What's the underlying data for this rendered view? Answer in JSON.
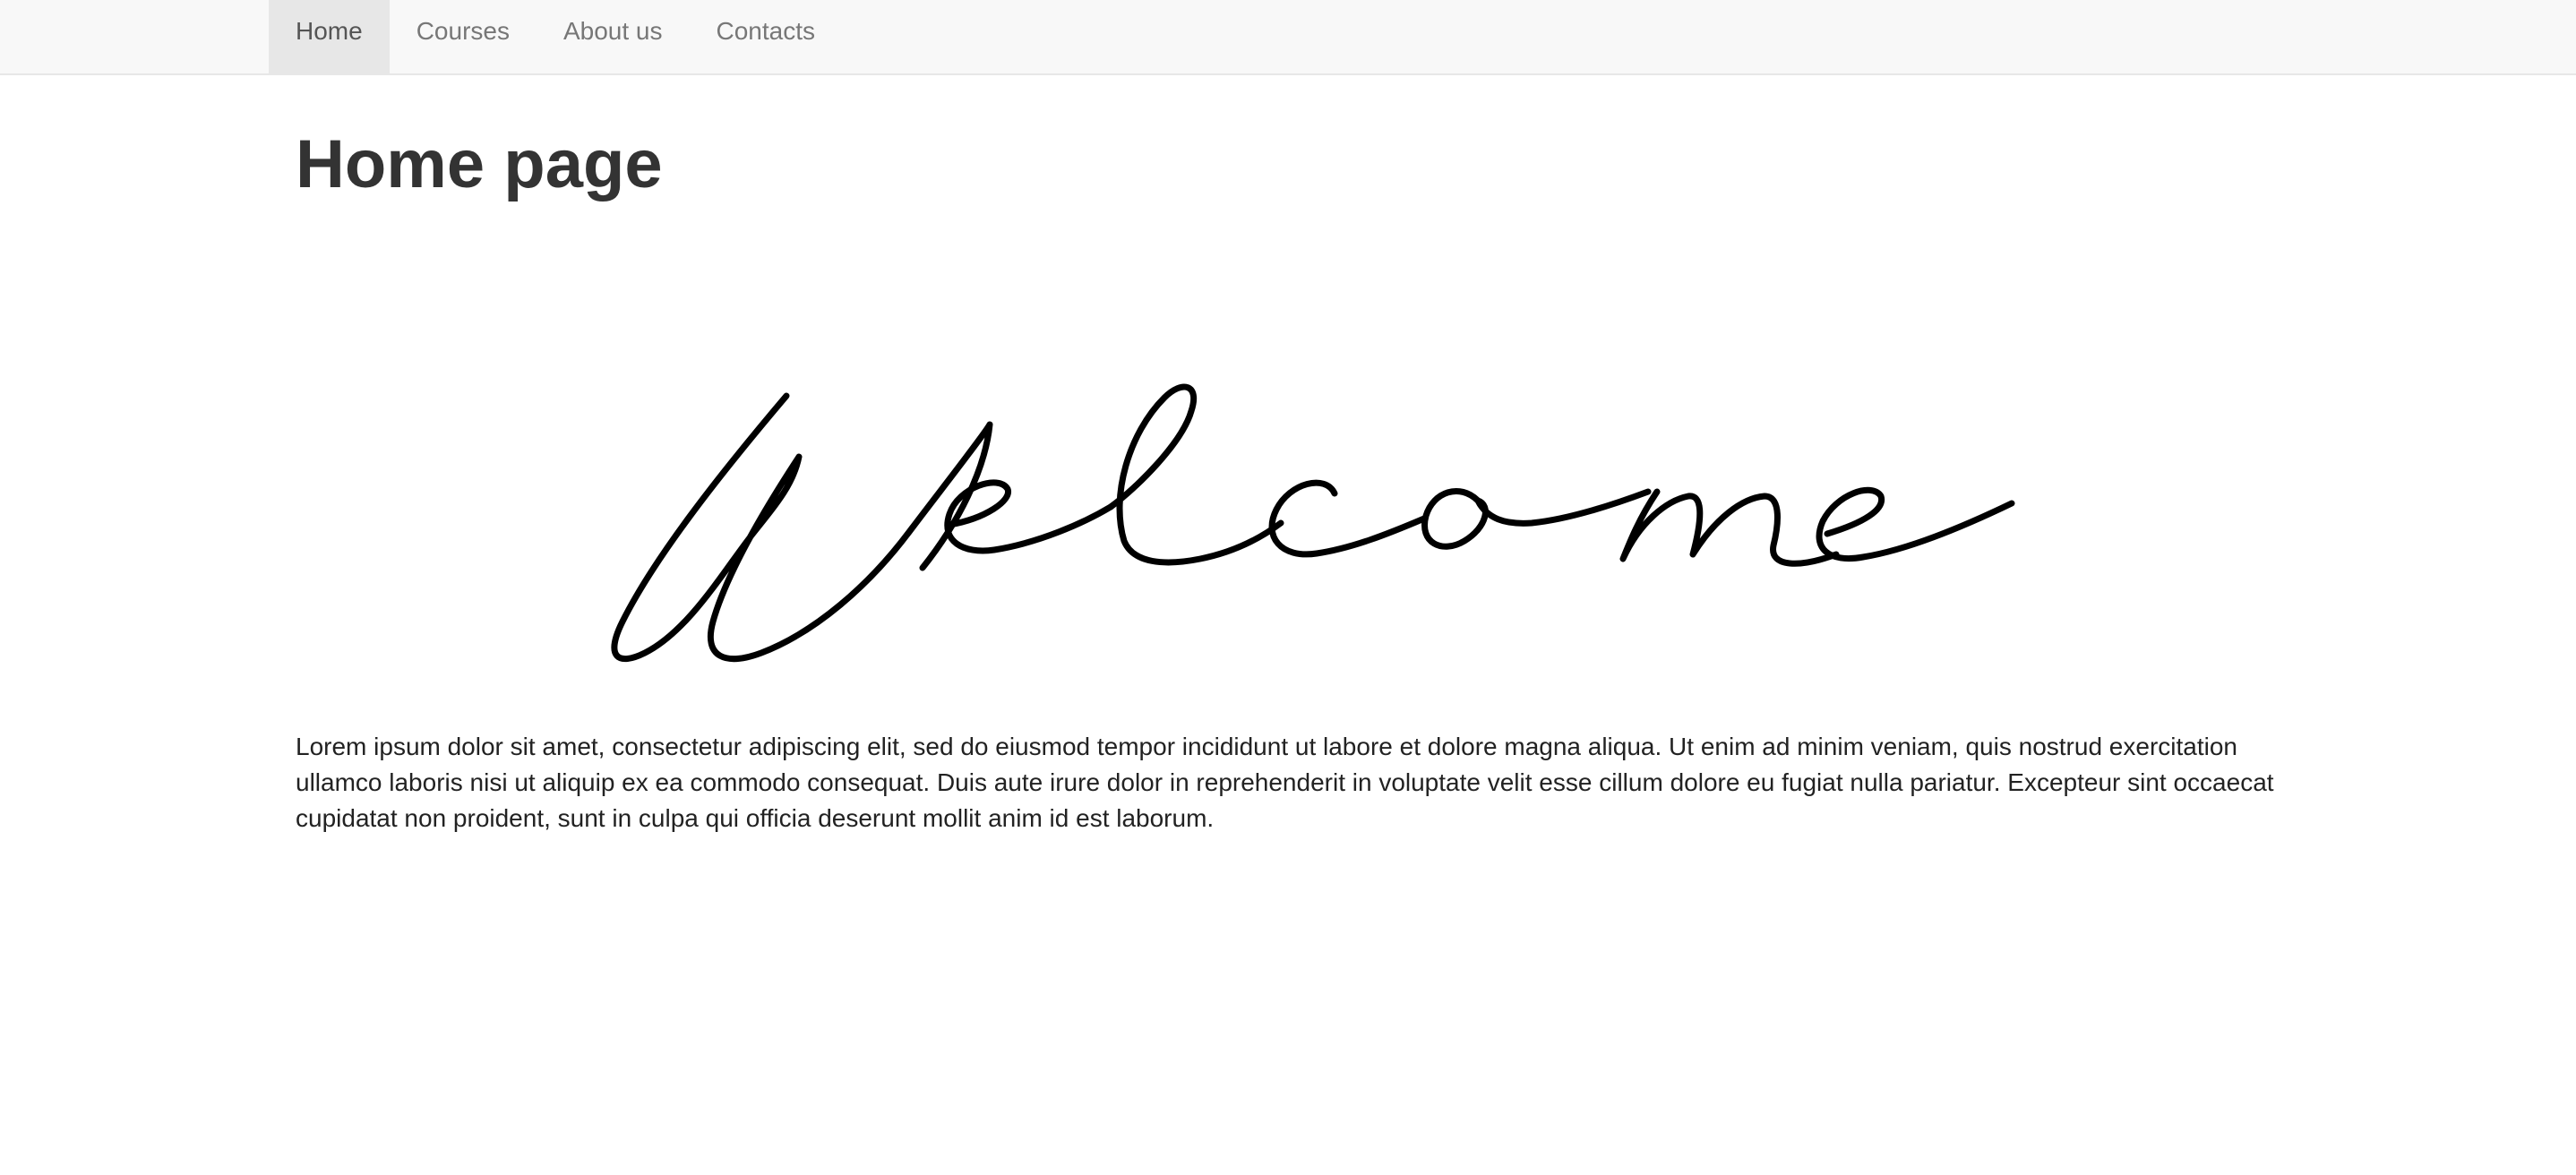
{
  "nav": {
    "items": [
      {
        "label": "Home",
        "active": true
      },
      {
        "label": "Courses",
        "active": false
      },
      {
        "label": "About us",
        "active": false
      },
      {
        "label": "Contacts",
        "active": false
      }
    ]
  },
  "main": {
    "title": "Home page",
    "banner_text": "Welcome",
    "body": "Lorem ipsum dolor sit amet, consectetur adipiscing elit, sed do eiusmod tempor incididunt ut labore et dolore magna aliqua. Ut enim ad minim veniam, quis nostrud exercitation ullamco laboris nisi ut aliquip ex ea commodo consequat. Duis aute irure dolor in reprehenderit in voluptate velit esse cillum dolore eu fugiat nulla pariatur. Excepteur sint occaecat cupidatat non proident, sunt in culpa qui officia deserunt mollit anim id est laborum."
  },
  "colors": {
    "navbar_bg": "#f8f8f8",
    "nav_active_bg": "#e7e7e7",
    "nav_text": "#777777",
    "title_text": "#333333"
  }
}
